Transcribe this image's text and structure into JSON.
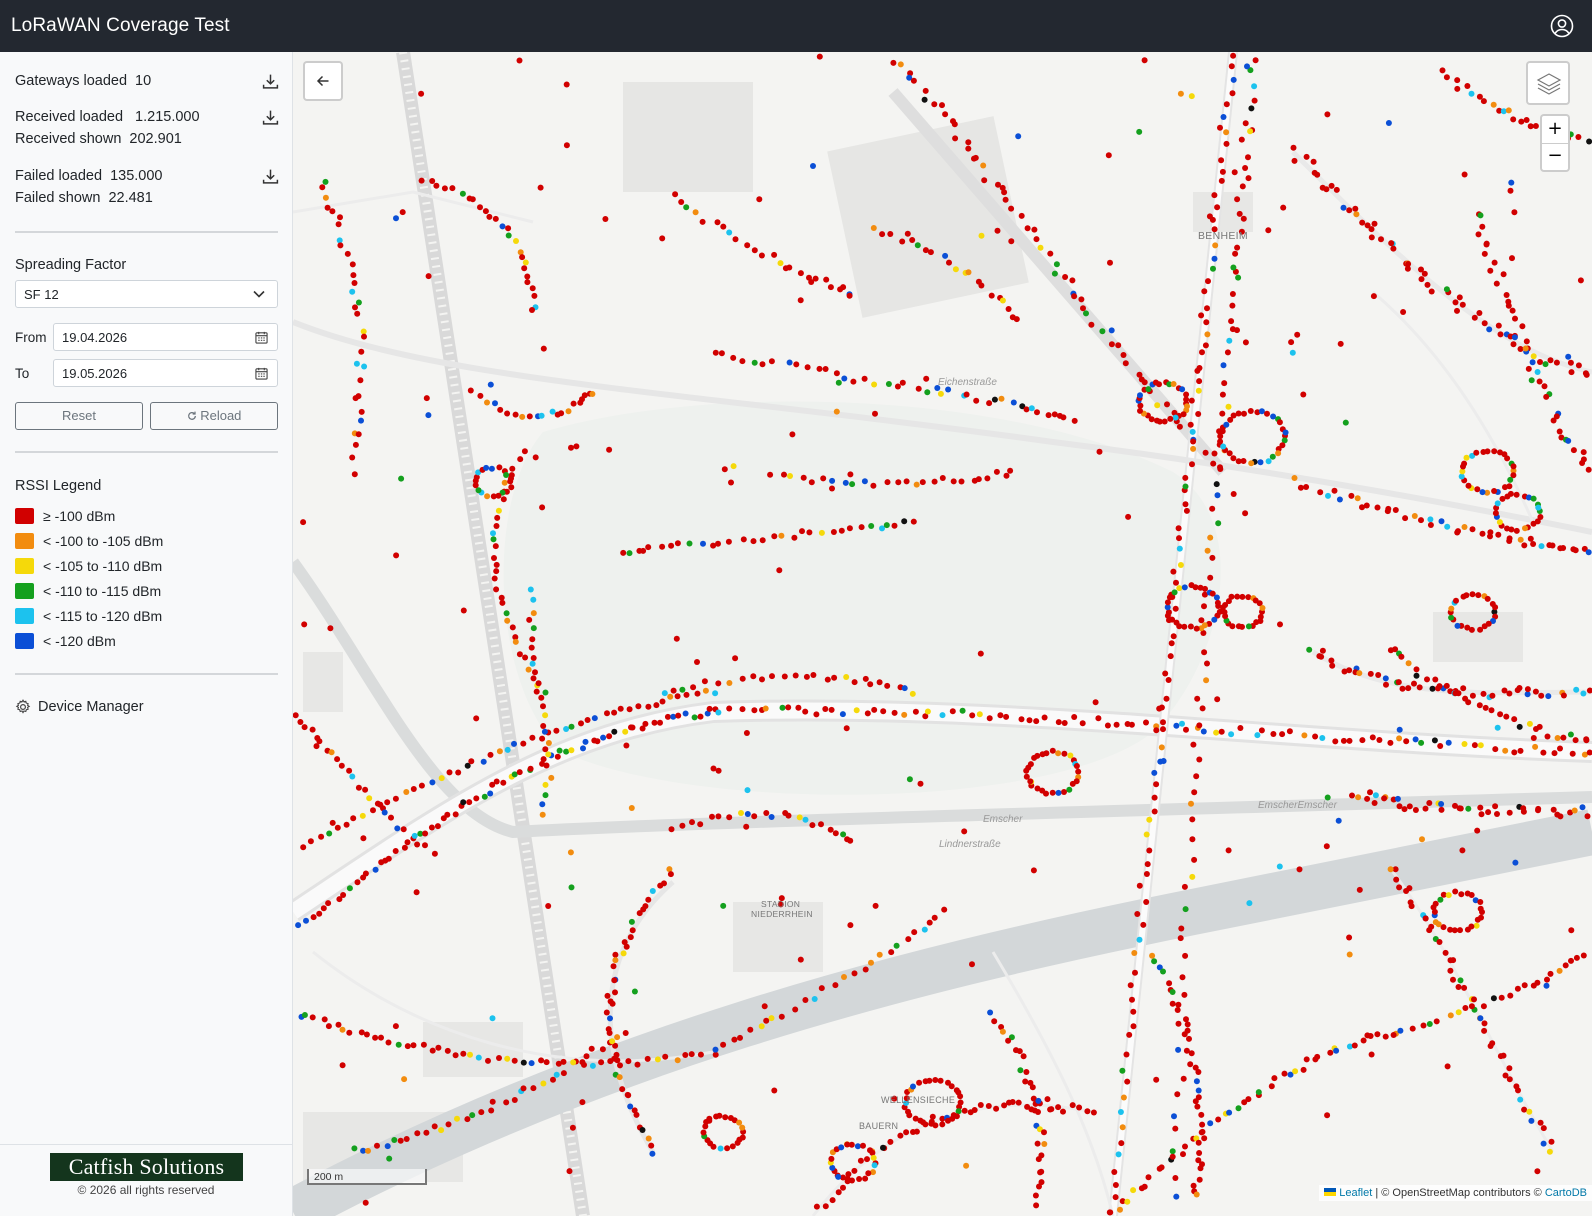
{
  "app": {
    "title": "LoRaWAN Coverage Test"
  },
  "header": {
    "user_icon": "user-circle-icon"
  },
  "stats": {
    "gateways_loaded_label": "Gateways loaded",
    "gateways_loaded_value": "10",
    "received_loaded_label": "Received loaded",
    "received_loaded_value": "1.215.000",
    "received_shown_label": "Received shown",
    "received_shown_value": "202.901",
    "failed_loaded_label": "Failed loaded",
    "failed_loaded_value": "135.000",
    "failed_shown_label": "Failed shown",
    "failed_shown_value": "22.481"
  },
  "filters": {
    "spreading_factor_label": "Spreading Factor",
    "spreading_factor_value": "SF 12",
    "from_label": "From",
    "from_value": "19.04.2026",
    "to_label": "To",
    "to_value": "19.05.2026",
    "reset_label": "Reset",
    "reload_label": "Reload"
  },
  "legend": {
    "title": "RSSI Legend",
    "items": [
      {
        "label": "≥ -100 dBm",
        "color": "#d10000"
      },
      {
        "label": "< -100 to -105 dBm",
        "color": "#f28c0f"
      },
      {
        "label": "< -105 to -110 dBm",
        "color": "#f5d90a"
      },
      {
        "label": "< -110 to -115 dBm",
        "color": "#14a01e"
      },
      {
        "label": "< -115 to -120 dBm",
        "color": "#1cc2ee"
      },
      {
        "label": "< -120 dBm",
        "color": "#0b4fd6"
      }
    ]
  },
  "nav": {
    "device_manager_label": "Device Manager"
  },
  "footer": {
    "logo_text": "Catfish Solutions",
    "copyright": "© 2026 all rights reserved"
  },
  "map": {
    "scale_label": "200 m",
    "attribution_leaflet": "Leaflet",
    "attribution_rest": "| © OpenStreetMap contributors ©",
    "attribution_carto": "CartoDB",
    "labels": {
      "emscher_1": "Emscher",
      "emscher_2": "EmscherEmscher",
      "lindnerstrasse": "Lindnerstraße",
      "eichenstrasse": "Eichenstraße",
      "stadion_1": "STADION",
      "stadion_2": "NIEDERRHEIN",
      "benheim": "BENHEIM",
      "wellensiek": "WELLENSIECHE",
      "bauern": "BAUERN"
    }
  }
}
